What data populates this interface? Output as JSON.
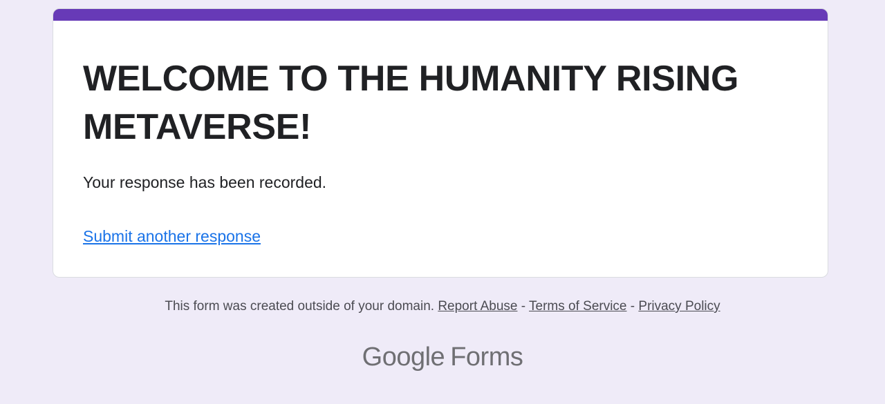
{
  "form": {
    "accent_color": "#673ab7",
    "title": "WELCOME TO THE HUMANITY RISING METAVERSE!",
    "confirmation_message": "Your response has been recorded.",
    "submit_another_label": "Submit another response",
    "link_color": "#1a73e8"
  },
  "footer": {
    "notice": "This form was created outside of your domain.",
    "separator": "-",
    "links": {
      "report_abuse": "Report Abuse",
      "terms_of_service": "Terms of Service",
      "privacy_policy": "Privacy Policy"
    }
  },
  "branding": {
    "company": "Google",
    "product": "Forms"
  }
}
